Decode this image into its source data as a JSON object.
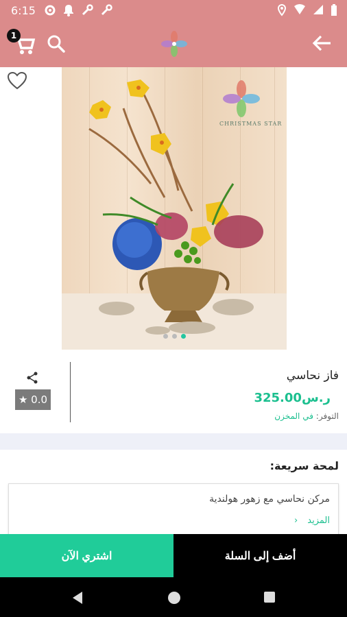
{
  "status_bar": {
    "time": "6:15"
  },
  "header": {
    "cart_count": "1"
  },
  "product": {
    "brand_text": "CHRISTMAS STAR",
    "title": "فاز نحاسي",
    "price": "325.00ر.س",
    "stock_label": "التوفر:",
    "stock_value": "في المخزن",
    "rating": "★ 0.0"
  },
  "glimpse": {
    "title": "لمحة سريعة:",
    "description": "مركن نحاسي مع زهور هولندية",
    "more_label": "المزيد",
    "more_arrow": "‹"
  },
  "actions": {
    "buy_now": "اشتري الآن",
    "add_to_cart": "أضف إلى السلة"
  },
  "colors": {
    "header": "#db8b8b",
    "accent": "#20cc99",
    "price": "#1bbf8f"
  }
}
